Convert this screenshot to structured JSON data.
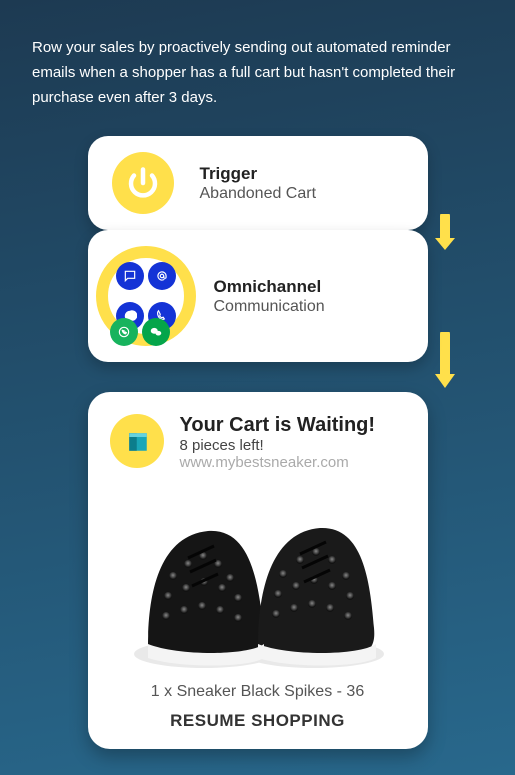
{
  "intro_text": "Row your sales by proactively sending out automated reminder emails when a shopper has a full cart but hasn't completed their purchase even after 3 days.",
  "trigger": {
    "title": "Trigger",
    "subtitle": "Abandoned Cart"
  },
  "omnichannel": {
    "title": "Omnichannel",
    "subtitle": "Communication"
  },
  "email": {
    "headline": "Your Cart is Waiting!",
    "stock_text": "8 pieces left!",
    "site_url": "www.mybestsneaker.com",
    "product_line": "1 x Sneaker Black Spikes - 36",
    "cta_label": "RESUME SHOPPING"
  },
  "colors": {
    "accent_yellow": "#ffe04b",
    "brand_blue": "#1433d6"
  },
  "icon_names": {
    "power": "power-icon",
    "sms": "sms-icon",
    "email": "at-sign-icon",
    "messenger": "messenger-icon",
    "viber": "viber-icon",
    "whatsapp": "whatsapp-icon",
    "wechat": "wechat-icon",
    "package": "package-icon",
    "arrow": "down-arrow-icon"
  }
}
